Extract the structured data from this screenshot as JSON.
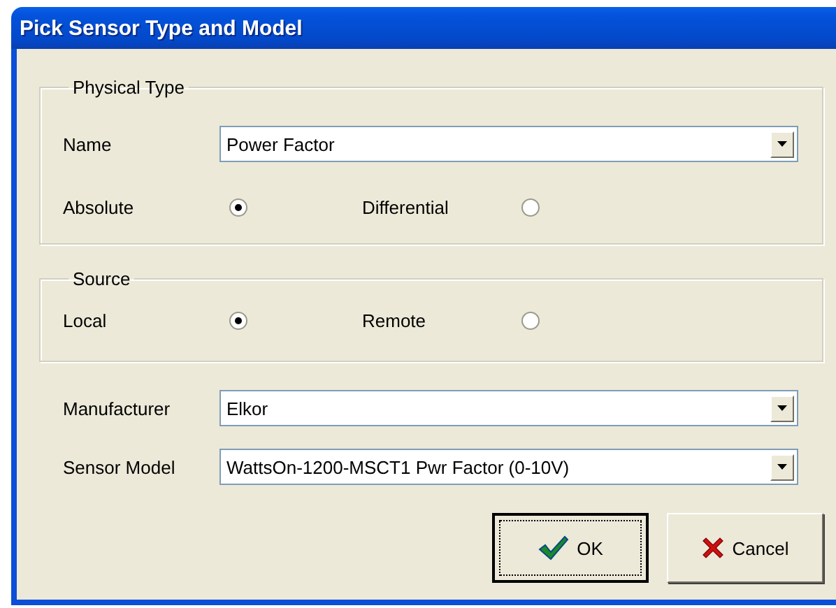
{
  "window": {
    "title": "Pick Sensor Type and Model"
  },
  "physical_type": {
    "legend": "Physical Type",
    "name": {
      "label": "Name",
      "value": "Power Factor"
    },
    "options": [
      {
        "label": "Absolute",
        "selected": true
      },
      {
        "label": "Differential",
        "selected": false
      }
    ]
  },
  "source": {
    "legend": "Source",
    "options": [
      {
        "label": "Local",
        "selected": true
      },
      {
        "label": "Remote",
        "selected": false
      }
    ]
  },
  "manufacturer": {
    "label": "Manufacturer",
    "value": "Elkor"
  },
  "sensor_model": {
    "label": "Sensor Model",
    "value": "WattsOn-1200-MSCT1 Pwr Factor (0-10V)"
  },
  "buttons": [
    {
      "label": "OK",
      "kind": "ok",
      "default": true
    },
    {
      "label": "Cancel",
      "kind": "cancel",
      "default": false
    }
  ]
}
